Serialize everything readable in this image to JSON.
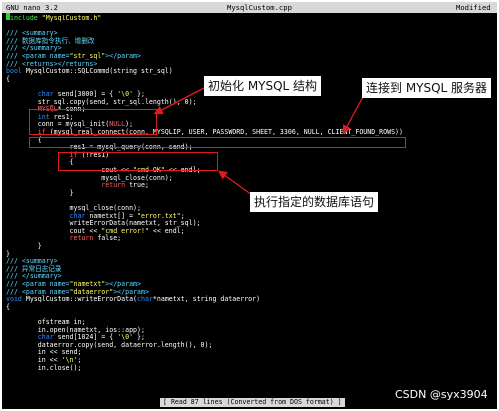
{
  "titlebar": {
    "app": "GNU nano 3.2",
    "filename": "MysqlCustom.cpp",
    "state": "Modified"
  },
  "lines": [
    [
      [
        "#include ",
        "pre"
      ],
      [
        "\"MysqlCustom.h\"",
        "str"
      ]
    ],
    [],
    [
      [
        "/// <summary>",
        "comment"
      ]
    ],
    [
      [
        "/// 数据库指令执行、增删改",
        "comment"
      ]
    ],
    [
      [
        "/// </summary>",
        "comment"
      ]
    ],
    [
      [
        "/// <param name=",
        "comment"
      ],
      [
        "\"str_sql\"",
        "str"
      ],
      [
        "></param>",
        "comment"
      ]
    ],
    [
      [
        "/// <returns></returns>",
        "comment"
      ]
    ],
    [
      [
        "bool",
        "type"
      ],
      [
        " MysqlCustom::SQLCommd(string str_sql)",
        "def"
      ]
    ],
    [
      [
        "{",
        "def"
      ]
    ],
    [],
    [
      [
        "        ",
        "def"
      ],
      [
        "char",
        "type"
      ],
      [
        " send[3000] = { ",
        "def"
      ],
      [
        "'\\0'",
        "str"
      ],
      [
        " };",
        "def"
      ]
    ],
    [
      [
        "        str_sql.copy(send, str_sql.length(), 0);",
        "def"
      ]
    ],
    [
      [
        "        ",
        "def"
      ],
      [
        "MYSQL",
        "kw"
      ],
      [
        "* conn;",
        "def"
      ]
    ],
    [
      [
        "        ",
        "def"
      ],
      [
        "int",
        "type"
      ],
      [
        " res1;",
        "def"
      ]
    ],
    [
      [
        "        conn = mysql_init(",
        "def"
      ],
      [
        "NULL",
        "kw"
      ],
      [
        ");",
        "def"
      ]
    ],
    [
      [
        "        ",
        "def"
      ],
      [
        "if",
        "kw"
      ],
      [
        " (mysql_real_connect(conn, MYSQLIP, USER, PASSWORD, SHEET, 3306, NULL, CLIENT_FOUND_ROWS))",
        "def"
      ]
    ],
    [
      [
        "        {",
        "def"
      ]
    ],
    [
      [
        "                res1 = mysql_query(conn, send);",
        "def"
      ]
    ],
    [
      [
        "                ",
        "def"
      ],
      [
        "if",
        "kw"
      ],
      [
        " (!res1)",
        "def"
      ]
    ],
    [
      [
        "                {",
        "def"
      ]
    ],
    [
      [
        "                        cout << ",
        "def"
      ],
      [
        "\"cmd OK\"",
        "str"
      ],
      [
        " << endl;",
        "def"
      ]
    ],
    [
      [
        "                        mysql_close(conn);",
        "def"
      ]
    ],
    [
      [
        "                        ",
        "def"
      ],
      [
        "return",
        "kw"
      ],
      [
        " true;",
        "def"
      ]
    ],
    [
      [
        "                }",
        "def"
      ]
    ],
    [],
    [
      [
        "                mysql_close(conn);",
        "def"
      ]
    ],
    [
      [
        "                ",
        "def"
      ],
      [
        "char",
        "type"
      ],
      [
        " nametxt[] = ",
        "def"
      ],
      [
        "\"error.txt\"",
        "str"
      ],
      [
        ";",
        "def"
      ]
    ],
    [
      [
        "                writeErrorData(nametxt, str_sql);",
        "def"
      ]
    ],
    [
      [
        "                cout << ",
        "def"
      ],
      [
        "\"cmd error!\"",
        "str"
      ],
      [
        " << endl;",
        "def"
      ]
    ],
    [
      [
        "                ",
        "def"
      ],
      [
        "return",
        "kw"
      ],
      [
        " false;",
        "def"
      ]
    ],
    [
      [
        "        }",
        "def"
      ]
    ],
    [
      [
        "}",
        "def"
      ]
    ],
    [
      [
        "/// <summary>",
        "comment"
      ]
    ],
    [
      [
        "/// 异常日志记录",
        "comment"
      ]
    ],
    [
      [
        "/// </summary>",
        "comment"
      ]
    ],
    [
      [
        "/// <param name=",
        "comment"
      ],
      [
        "\"nametxt\"",
        "str"
      ],
      [
        "></param>",
        "comment"
      ]
    ],
    [
      [
        "/// <param name=",
        "comment"
      ],
      [
        "\"dataerror\"",
        "str"
      ],
      [
        "></param>",
        "comment"
      ]
    ],
    [
      [
        "void",
        "type"
      ],
      [
        " MysqlCustom::writeErrorData(",
        "def"
      ],
      [
        "char",
        "type"
      ],
      [
        "*nametxt, string dataerror)",
        "def"
      ]
    ],
    [
      [
        "{",
        "def"
      ]
    ],
    [],
    [
      [
        "        ofstream in;",
        "def"
      ]
    ],
    [
      [
        "        in.open(nametxt, ios::app);",
        "def"
      ]
    ],
    [
      [
        "        ",
        "def"
      ],
      [
        "char",
        "type"
      ],
      [
        " send[1024] = { ",
        "def"
      ],
      [
        "'\\0'",
        "str"
      ],
      [
        " };",
        "def"
      ]
    ],
    [
      [
        "        dataerror.copy(send, dataerror.length(), 0);",
        "def"
      ]
    ],
    [
      [
        "        in << send;",
        "def"
      ]
    ],
    [
      [
        "        in << ",
        "def"
      ],
      [
        "'\\n'",
        "str"
      ],
      [
        ";",
        "def"
      ]
    ],
    [
      [
        "        in.close();",
        "def"
      ]
    ]
  ],
  "annotations": {
    "init": "初始化 MYSQL 结构",
    "connect": "连接到 MYSQL 服务器",
    "query": "执行指定的数据库语句"
  },
  "colors": {
    "annotation_red": "#e11b1b",
    "comment": "#5fd7ff",
    "string": "#ffff66",
    "keyword": "#ff5f5f",
    "type": "#2c8cff",
    "preprocessor": "#55e655"
  },
  "statusbar": {
    "message": "[ Read 87 lines (Converted from DOS format) ]"
  },
  "watermark": "CSDN @syx3904"
}
